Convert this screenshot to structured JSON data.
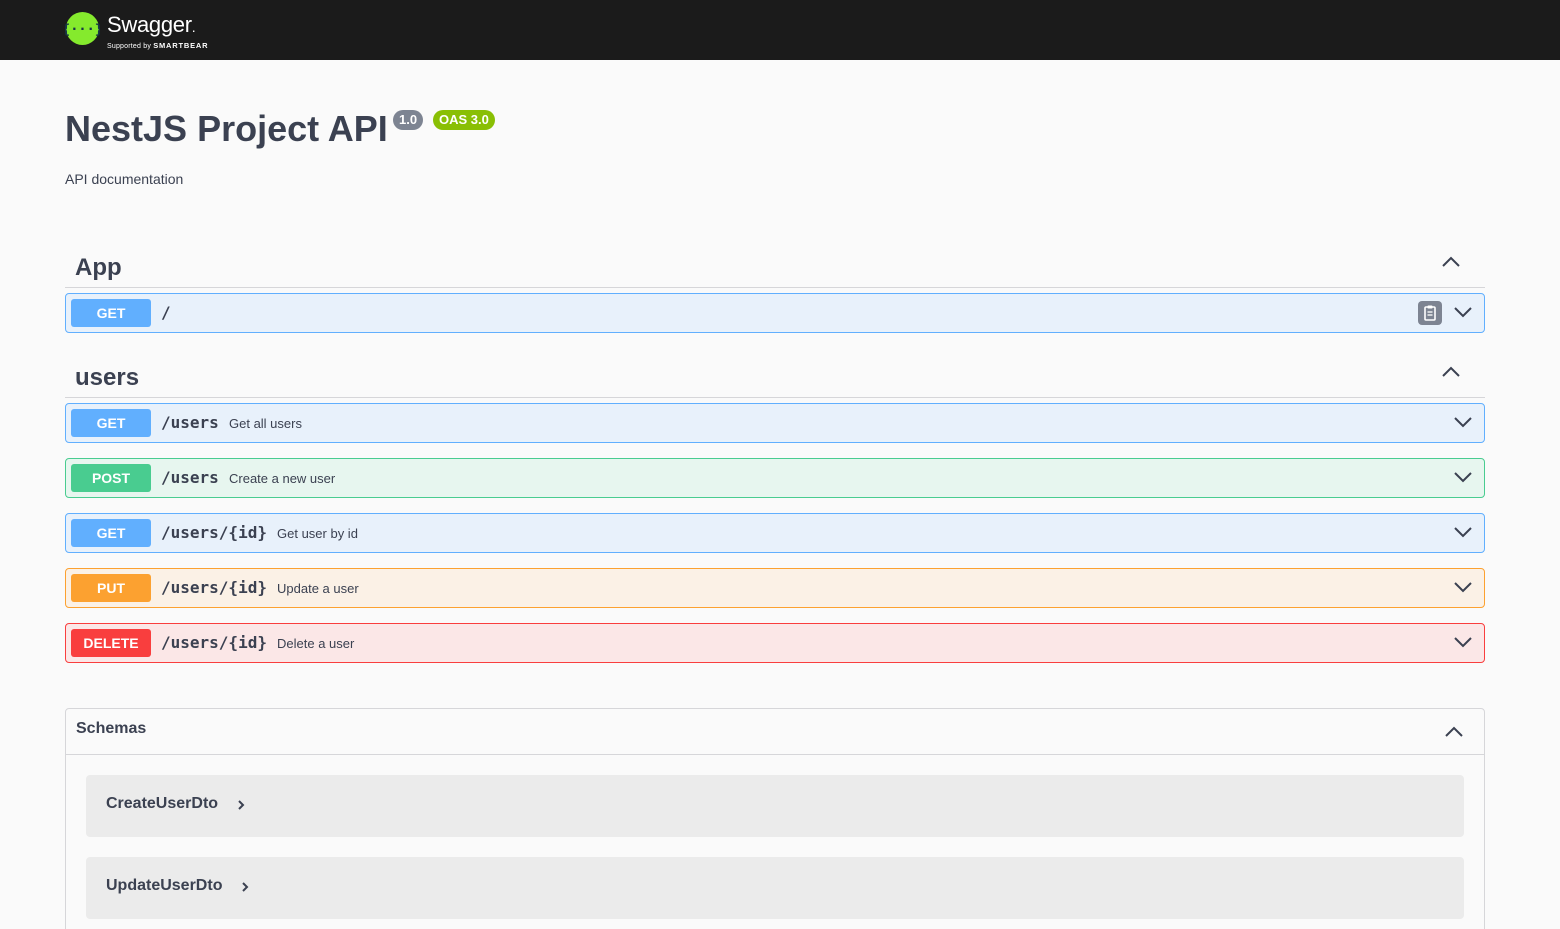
{
  "header": {
    "logo_text": "Swagger",
    "logo_dot": ".",
    "logo_sub_prefix": "Supported by",
    "logo_sub_brand": "SMARTBEAR",
    "colors": {
      "bar": "#1b1b1b",
      "logo_green": "#85ea2d"
    }
  },
  "info": {
    "title": "NestJS Project API",
    "version": "1.0",
    "oas": "OAS 3.0",
    "description": "API documentation"
  },
  "sections": {
    "app": {
      "name": "App",
      "toggle_icon": "chevron-up-icon",
      "operations": [
        {
          "method": "GET",
          "path": "/",
          "summary": "",
          "copy_icon": "clipboard-icon"
        }
      ]
    },
    "users": {
      "name": "users",
      "toggle_icon": "chevron-up-icon",
      "operations": [
        {
          "method": "GET",
          "path": "/users",
          "summary": "Get all users"
        },
        {
          "method": "POST",
          "path": "/users",
          "summary": "Create a new user"
        },
        {
          "method": "GET",
          "path": "/users/{id}",
          "summary": "Get user by id"
        },
        {
          "method": "PUT",
          "path": "/users/{id}",
          "summary": "Update a user"
        },
        {
          "method": "DELETE",
          "path": "/users/{id}",
          "summary": "Delete a user"
        }
      ]
    }
  },
  "schemas": {
    "title": "Schemas",
    "models": [
      "CreateUserDto",
      "UpdateUserDto"
    ]
  },
  "colors": {
    "get": "#61affe",
    "post": "#49cc90",
    "put": "#fca130",
    "delete": "#f93e3e",
    "version_badge": "#7d8492",
    "oas_badge": "#89bf04"
  }
}
